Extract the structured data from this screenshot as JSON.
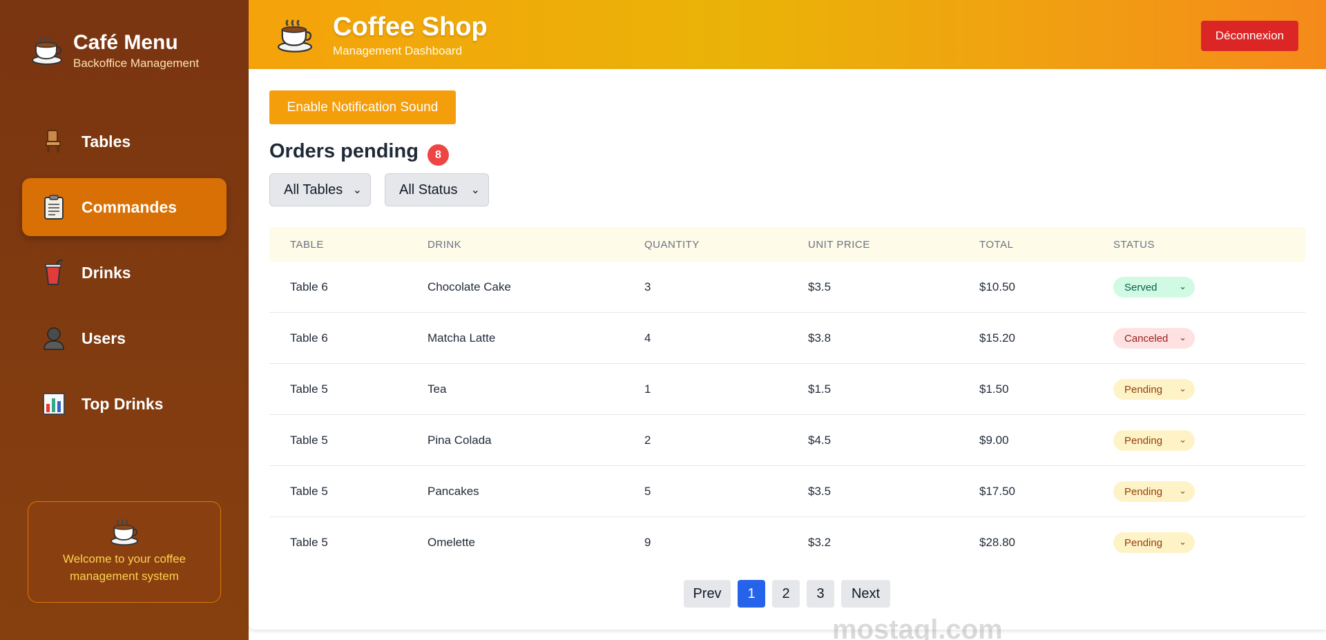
{
  "sidebar": {
    "brand_title": "Café Menu",
    "brand_subtitle": "Backoffice Management",
    "items": [
      {
        "label": "Tables",
        "icon": "chair-icon"
      },
      {
        "label": "Commandes",
        "icon": "clipboard-icon",
        "active": true
      },
      {
        "label": "Drinks",
        "icon": "cup-straw-icon"
      },
      {
        "label": "Users",
        "icon": "user-icon"
      },
      {
        "label": "Top Drinks",
        "icon": "bar-chart-icon"
      }
    ],
    "welcome_text": "Welcome to your coffee management system"
  },
  "header": {
    "title": "Coffee Shop",
    "subtitle": "Management Dashboard",
    "logout_label": "Déconnexion"
  },
  "main": {
    "notify_label": "Enable Notification Sound",
    "orders_title": "Orders pending",
    "orders_count": "8",
    "filters": {
      "tables": "All Tables",
      "status": "All Status"
    },
    "columns": [
      "TABLE",
      "DRINK",
      "QUANTITY",
      "UNIT PRICE",
      "TOTAL",
      "STATUS"
    ],
    "rows": [
      {
        "table": "Table 6",
        "drink": "Chocolate Cake",
        "qty": "3",
        "unit": "$3.5",
        "total": "$10.50",
        "status": "Served",
        "status_kind": "served"
      },
      {
        "table": "Table 6",
        "drink": "Matcha Latte",
        "qty": "4",
        "unit": "$3.8",
        "total": "$15.20",
        "status": "Canceled",
        "status_kind": "canceled"
      },
      {
        "table": "Table 5",
        "drink": "Tea",
        "qty": "1",
        "unit": "$1.5",
        "total": "$1.50",
        "status": "Pending",
        "status_kind": "pending"
      },
      {
        "table": "Table 5",
        "drink": "Pina Colada",
        "qty": "2",
        "unit": "$4.5",
        "total": "$9.00",
        "status": "Pending",
        "status_kind": "pending"
      },
      {
        "table": "Table 5",
        "drink": "Pancakes",
        "qty": "5",
        "unit": "$3.5",
        "total": "$17.50",
        "status": "Pending",
        "status_kind": "pending"
      },
      {
        "table": "Table 5",
        "drink": "Omelette",
        "qty": "9",
        "unit": "$3.2",
        "total": "$28.80",
        "status": "Pending",
        "status_kind": "pending"
      }
    ],
    "pager": {
      "prev": "Prev",
      "pages": [
        "1",
        "2",
        "3"
      ],
      "current": "1",
      "next": "Next"
    }
  },
  "watermark": "mostaql.com",
  "colors": {
    "sidebar": "#7a3511",
    "active_nav": "#d97006",
    "header": "#eab308",
    "logout": "#dc2626",
    "accent": "#f59e0b",
    "page_active": "#2563eb"
  }
}
